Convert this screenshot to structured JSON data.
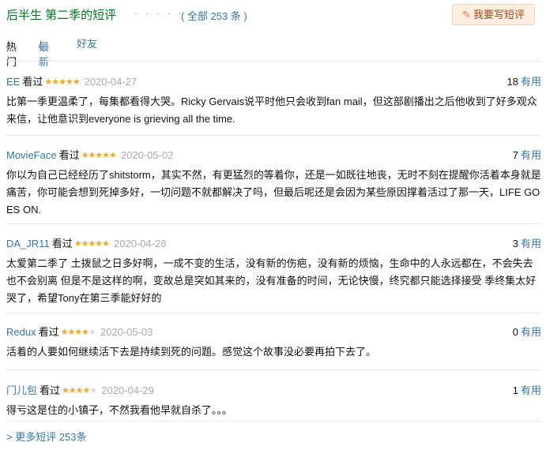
{
  "header": {
    "title": "后半生 第二季的短评",
    "dots": "· · · · · ·",
    "total": "( 全部 253 条 )",
    "write_button": "我要写短评"
  },
  "filters": {
    "hot": "热门",
    "latest": "最新",
    "friends": "好友",
    "separator": "/"
  },
  "watched_label": "看过",
  "useful_label": "有用",
  "star_color": "#f5a623",
  "link_color": "#3377aa",
  "reviews": [
    {
      "user": "EE",
      "rating": 5,
      "date": "2020-04-27",
      "votes": "18",
      "content": "比第一季更温柔了，每集都看得大哭。Ricky Gervais说平时他只会收到fan mail，但这部剧播出之后他收到了好多观众来信，让他意识到everyone is grieving all the time."
    },
    {
      "user": "MovieFace",
      "rating": 5,
      "date": "2020-05-02",
      "votes": "7",
      "content": "你以为自己已经经历了shitstorm，其实不然，有更猛烈的等着你，还是一如既往地丧，无时不刻在提醒你活着本身就是痛苦，你可能会想到死掉多好，一切问题不就都解决了吗，但最后呢还是会因为某些原因撑着活过了那一天，LIFE GOES ON."
    },
    {
      "user": "DA_JR11",
      "rating": 5,
      "date": "2020-04-28",
      "votes": "3",
      "content": "太爱第二季了 土拨鼠之日多好啊，一成不变的生活，没有新的伤疤，没有新的烦恼，生命中的人永远都在，不会失去也不会别离 但是不是这样的啊，变故总是突如其来的，没有准备的时间，无论快慢，终究都只能选择接受 季终集太好哭了，希望Tony在第三季能好好的"
    },
    {
      "user": "Redux",
      "rating": 4,
      "date": "2020-05-03",
      "votes": "0",
      "content": "活着的人要如何继续活下去是持续到死的问题。感觉这个故事没必要再拍下去了。"
    },
    {
      "user": "门儿包",
      "rating": 4,
      "date": "2020-04-29",
      "votes": "1",
      "content": "得亏这是住的小镇子，不然我看他早就自杀了。。。"
    }
  ],
  "more_link": "> 更多短评 253条"
}
